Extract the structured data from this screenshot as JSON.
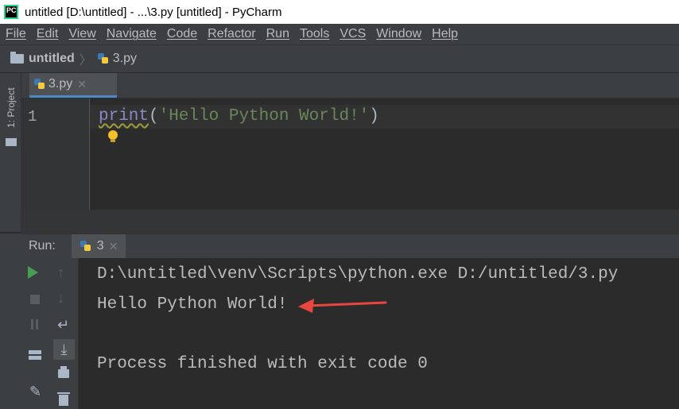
{
  "window": {
    "title": "untitled [D:\\untitled] - ...\\3.py [untitled] - PyCharm",
    "logo_text": "PC"
  },
  "menu": [
    "File",
    "Edit",
    "View",
    "Navigate",
    "Code",
    "Refactor",
    "Run",
    "Tools",
    "VCS",
    "Window",
    "Help"
  ],
  "breadcrumb": {
    "project": "untitled",
    "file": "3.py"
  },
  "left_strip": {
    "project_tab": "1: Project"
  },
  "editor": {
    "tab_label": "3.py",
    "line_number": "1",
    "code": {
      "func": "print",
      "open": "(",
      "string": "'Hello Python World!'",
      "close": ")"
    }
  },
  "run": {
    "title": "Run:",
    "tab_label": "3",
    "output": [
      "D:\\untitled\\venv\\Scripts\\python.exe D:/untitled/3.py",
      "Hello Python World!",
      "",
      "Process finished with exit code 0"
    ]
  },
  "colors": {
    "annotation_arrow": "#e8463f"
  }
}
